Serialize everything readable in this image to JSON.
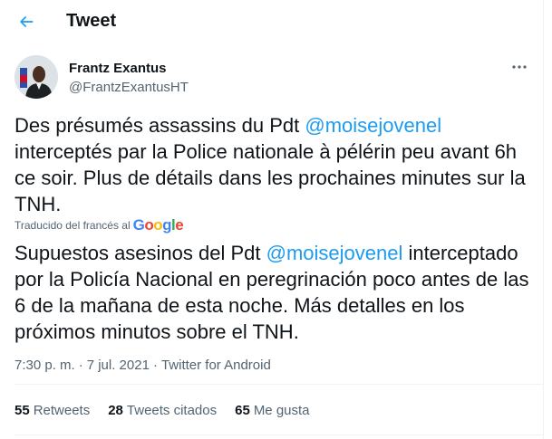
{
  "header": {
    "title": "Tweet",
    "back_icon": "arrow-left-icon"
  },
  "colors": {
    "accent": "#1d9bf0",
    "text": "#0f1419",
    "secondary": "#536471",
    "divider": "#eff3f4"
  },
  "author": {
    "name": "Frantz Exantus",
    "handle": "@FrantzExantusHT",
    "more_icon": "more-horizontal-icon"
  },
  "tweet": {
    "text_before": "Des présumés assassins du Pdt ",
    "mention": "@moisejovenel",
    "text_after": " interceptés par la Police nationale à pélérin peu avant 6h ce soir. Plus de détails dans les prochaines minutes sur la TNH."
  },
  "translation": {
    "label": "Traducido del francés al",
    "provider": "Google",
    "text_before": "Supuestos asesinos del Pdt ",
    "mention": "@moisejovenel",
    "text_after": " interceptado por la Policía Nacional en peregrinación poco antes de las 6 de la mañana de esta noche. Más detalles en los próximos minutos sobre el TNH."
  },
  "meta": {
    "time": "7:30 p. m.",
    "separator": "·",
    "date": "7 jul. 2021",
    "source": "Twitter for Android"
  },
  "stats": [
    {
      "count": "55",
      "label": "Retweets"
    },
    {
      "count": "28",
      "label": "Tweets citados"
    },
    {
      "count": "65",
      "label": "Me gusta"
    }
  ]
}
